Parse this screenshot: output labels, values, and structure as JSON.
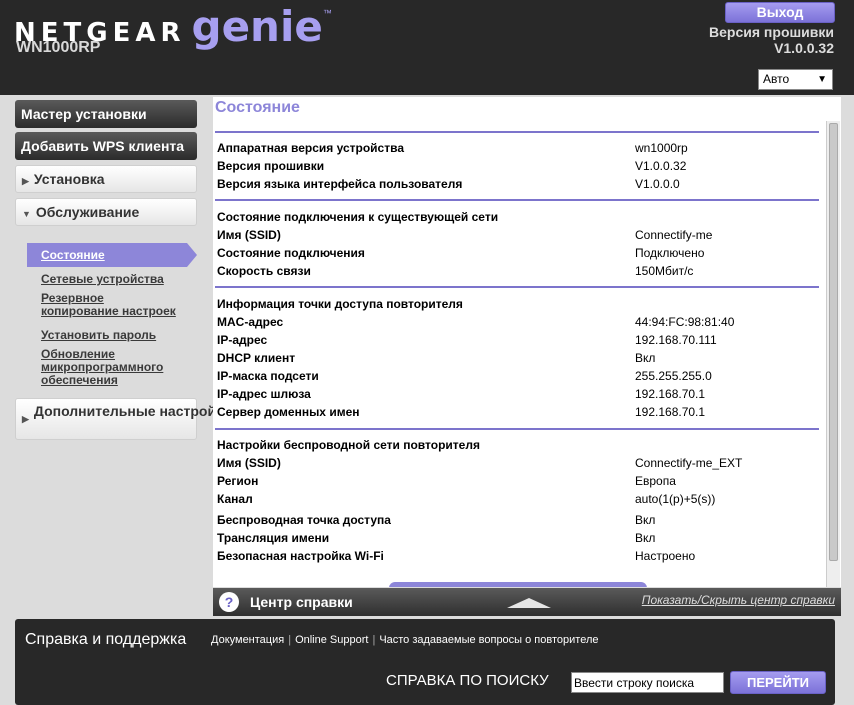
{
  "header": {
    "brand_name": "NETGEAR",
    "brand_product": "genie",
    "brand_tm": "™",
    "model": "WN1000RP",
    "logout_label": "Выход",
    "firmware_label": "Версия прошивки",
    "firmware_version": "V1.0.0.32",
    "language": {
      "selected": "Авто",
      "arrow": "▼"
    }
  },
  "sidebar": {
    "setup_wizard": "Мастер установки",
    "add_wps": "Добавить WPS клиента",
    "setup": "Установка",
    "maintenance": "Обслуживание",
    "advanced": "Дополнительные настройки",
    "collapsed_marker": "▶",
    "expanded_marker": "▼",
    "submenu": {
      "active": "Состояние",
      "items": [
        "Сетевые устройства",
        "Резервное копирование настроек",
        "Установить пароль",
        "Обновление микропрограммного обеспечения"
      ]
    }
  },
  "main": {
    "title": "Состояние",
    "hardware": [
      {
        "k": "Аппаратная версия устройства",
        "v": "wn1000rp"
      },
      {
        "k": "Версия прошивки",
        "v": "V1.0.0.32"
      },
      {
        "k": "Версия языка интерфейса пользователя",
        "v": "V1.0.0.0"
      }
    ],
    "connection": {
      "title": "Состояние подключения к существующей сети",
      "rows": [
        {
          "k": "Имя (SSID)",
          "v": "Connectify-me"
        },
        {
          "k": "Состояние подключения",
          "v": "Подключено"
        },
        {
          "k": "Скорость связи",
          "v": "150Мбит/с"
        }
      ]
    },
    "ap_info": {
      "title": "Информация точки доступа повторителя",
      "rows": [
        {
          "k": "MAC-адрес",
          "v": "44:94:FC:98:81:40"
        },
        {
          "k": "IP-адрес",
          "v": "192.168.70.111"
        },
        {
          "k": "DHCP клиент",
          "v": "Вкл"
        },
        {
          "k": "IP-маска подсети",
          "v": "255.255.255.0"
        },
        {
          "k": "IP-адрес шлюза",
          "v": "192.168.70.1"
        },
        {
          "k": "Сервер доменных имен",
          "v": "192.168.70.1"
        }
      ]
    },
    "wireless": {
      "title": "Настройки беспроводной сети повторителя",
      "rows": [
        {
          "k": "Имя (SSID)",
          "v": "Connectify-me_EXT"
        },
        {
          "k": "Регион",
          "v": "Европа"
        },
        {
          "k": "Канал",
          "v": "auto(1(p)+5(s))"
        },
        {
          "k": "Беспроводная точка доступа",
          "v": "Вкл"
        },
        {
          "k": "Трансляция имени",
          "v": "Вкл"
        },
        {
          "k": "Безопасная настройка Wi-Fi",
          "v": "Настроено"
        }
      ]
    }
  },
  "help_bar": {
    "icon_glyph": "?",
    "title": "Центр справки",
    "toggle": "Показать/Скрыть центр справки"
  },
  "footer": {
    "title": "Справка и поддержка",
    "links": [
      "Документация",
      "Online Support",
      "Часто задаваемые вопросы о повторителе"
    ],
    "link_separator": "|",
    "search_label": "СПРАВКА ПО ПОИСКУ",
    "search_placeholder": "Ввести строку поиска",
    "search_button": "ПЕРЕЙТИ"
  },
  "colors": {
    "accent": "#8d86d9",
    "header_bg": "#282828",
    "button_purple": "#7c72d8"
  }
}
